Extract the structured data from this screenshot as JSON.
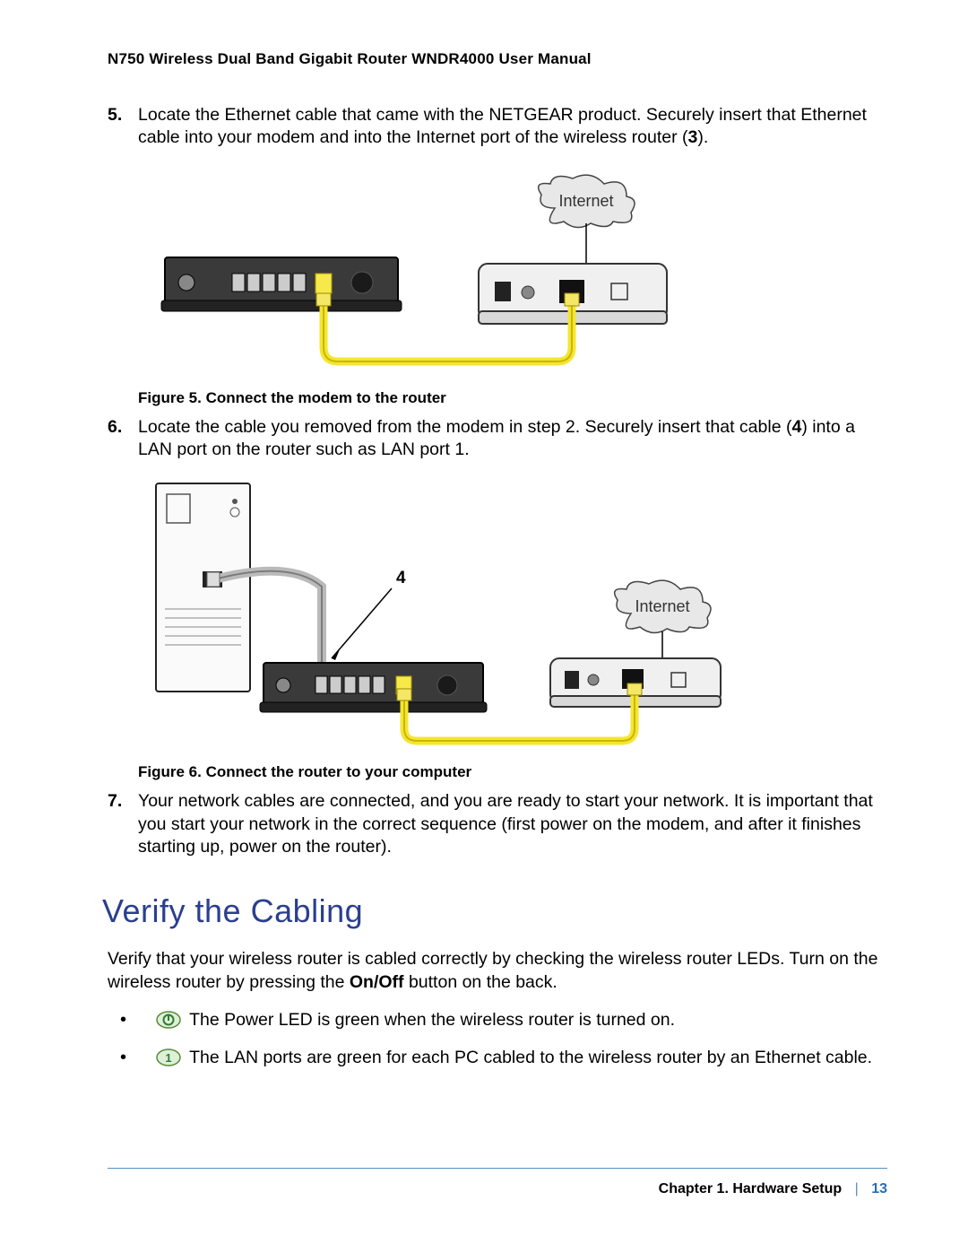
{
  "header": {
    "title": "N750 Wireless Dual Band Gigabit Router WNDR4000 User Manual"
  },
  "steps": {
    "s5": {
      "num": "5.",
      "text_a": "Locate the Ethernet cable that came with the NETGEAR product. Securely insert that Ethernet cable into your modem and into the Internet port of the wireless router (",
      "bold_a": "3",
      "text_b": ")."
    },
    "s6": {
      "num": "6.",
      "text_a": "Locate the cable you removed from the modem in step 2. Securely insert that cable (",
      "bold_a": "4",
      "text_b": ") into a LAN port on the router such as LAN port 1."
    },
    "s7": {
      "num": "7.",
      "text": "Your network cables are connected, and you are ready to start your network. It is important that you start your network in the correct sequence (first power on the modem, and after it finishes starting up, power on the router)."
    }
  },
  "figures": {
    "f5": {
      "caption": "Figure 5.  Connect the modem to the router",
      "internet_label": "Internet"
    },
    "f6": {
      "caption": "Figure 6.  Connect the router to your computer",
      "internet_label": "Internet",
      "callout": "4"
    }
  },
  "section": {
    "title": "Verify the Cabling",
    "intro_a": "Verify that your wireless router is cabled correctly by checking the wireless router LEDs. Turn on the wireless router by pressing the ",
    "intro_bold": "On/Off",
    "intro_b": " button on the back.",
    "bullets": {
      "b1": "The Power LED is green when the wireless router is turned on.",
      "b2": "The LAN ports are green for each PC cabled to the wireless router by an Ethernet cable."
    }
  },
  "footer": {
    "chapter": "Chapter 1.  Hardware Setup",
    "sep": "|",
    "page": "13"
  },
  "icons": {
    "power": "power-icon",
    "lan1": "lan-1-icon"
  }
}
